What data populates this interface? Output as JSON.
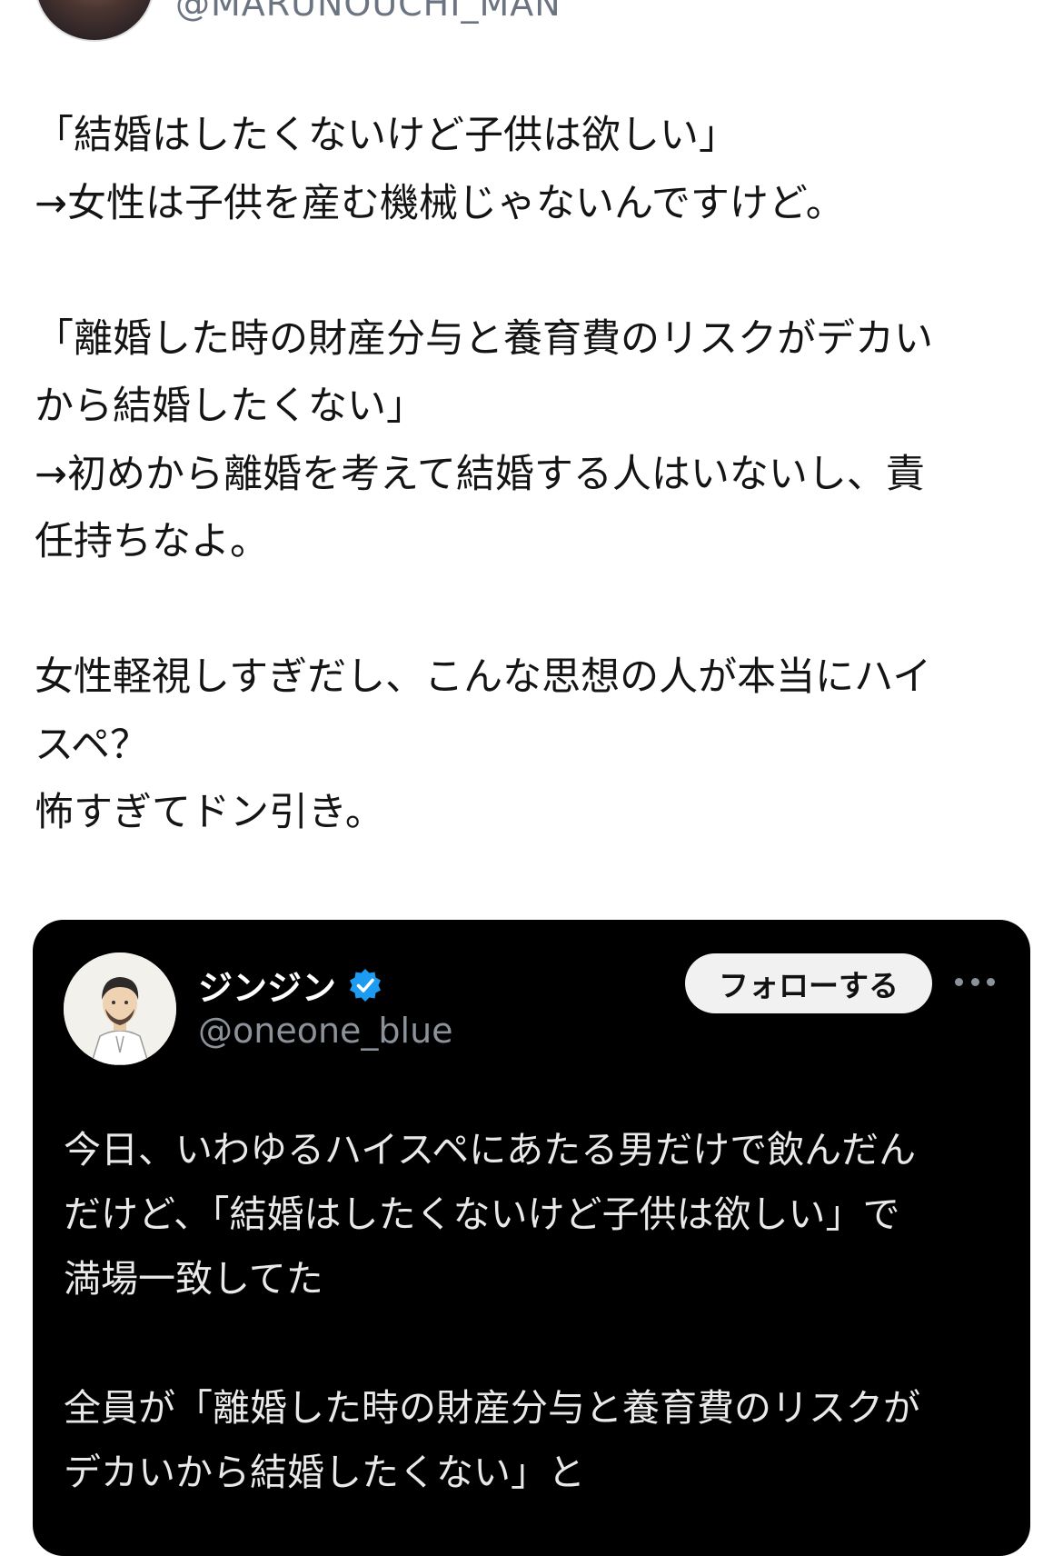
{
  "header": {
    "handle": "@MARUNOUCHI_MAN"
  },
  "post": {
    "text": "「結婚はしたくないけど子供は欲しい」\n→女性は子供を産む機械じゃないんですけど。\n\n「離婚した時の財産分与と養育費のリスクがデカい\nから結婚したくない」\n→初めから離婚を考えて結婚する人はいないし、責\n任持ちなよ。\n\n女性軽視しすぎだし、こんな思想の人が本当にハイ\nスペ？\n怖すぎてドン引き。"
  },
  "quoted_post": {
    "name": "ジンジン",
    "handle": "@oneone_blue",
    "follow_label": "フォローする",
    "text": "今日、いわゆるハイスペにあたる男だけで飲んだん\nだけど、「結婚はしたくないけど子供は欲しい」で\n満場一致してた\n\n全員が「離婚した時の財産分与と養育費のリスクが\nデカいから結婚したくない」と"
  },
  "colors": {
    "card_background": "#000000",
    "verified_blue": "#1d9bf0",
    "muted_text": "#8b929a"
  },
  "icons": {
    "verified": "verified-badge-icon",
    "more": "more-options-icon"
  }
}
